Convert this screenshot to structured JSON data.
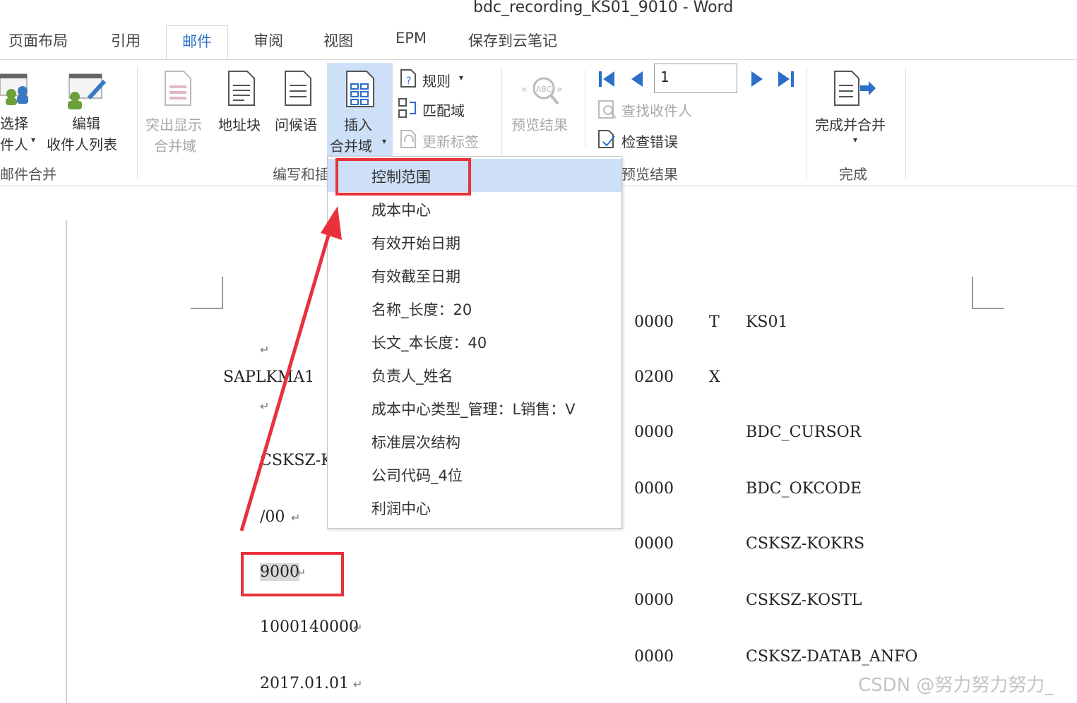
{
  "window": {
    "title": "bdc_recording_KS01_9010 - Word"
  },
  "tabs": [
    {
      "label": "页面布局"
    },
    {
      "label": "引用"
    },
    {
      "label": "邮件",
      "active": true
    },
    {
      "label": "审阅"
    },
    {
      "label": "视图"
    },
    {
      "label": "EPM"
    },
    {
      "label": "保存到云笔记"
    }
  ],
  "ribbon": {
    "groups": {
      "mail_merge": "邮件合并",
      "write_insert": "编写和插",
      "preview": "预览结果",
      "finish": "完成"
    },
    "buttons": {
      "select_recipients_1": "选择",
      "select_recipients_2": "件人",
      "edit_recipients_1": "编辑",
      "edit_recipients_2": "收件人列表",
      "highlight_1": "突出显示",
      "highlight_2": "合并域",
      "address_block": "地址块",
      "greeting": "问候语",
      "insert_field_1": "插入",
      "insert_field_2": "合并域",
      "rules": "规则",
      "match_fields": "匹配域",
      "update_labels": "更新标签",
      "preview_results": "预览结果",
      "find_recipient": "查找收件人",
      "check_errors": "检查错误",
      "finish_merge": "完成并合并"
    },
    "record_number": "1"
  },
  "dropdown": {
    "items": [
      "控制范围",
      "成本中心",
      "有效开始日期",
      "有效截至日期",
      "名称_长度：20",
      "长文_本长度：40",
      "负责人_姓名",
      "成本中心类型_管理：L销售：V",
      "标准层次结构",
      "公司代码_4位",
      "利润中心"
    ],
    "highlighted_index": 0
  },
  "document": {
    "left_column": [
      "SAPLKMA1",
      "CSKSZ-K",
      "/00",
      "9000",
      "1000140000",
      "2017.01.01"
    ],
    "rows": [
      {
        "num": "0000",
        "flag": "T",
        "field": "KS01"
      },
      {
        "num": "0200",
        "flag": "X",
        "field": ""
      },
      {
        "num": "0000",
        "flag": "",
        "field": "BDC_CURSOR"
      },
      {
        "num": "0000",
        "flag": "",
        "field": "BDC_OKCODE"
      },
      {
        "num": "0000",
        "flag": "",
        "field": "CSKSZ-KOKRS"
      },
      {
        "num": "0000",
        "flag": "",
        "field": "CSKSZ-KOSTL"
      },
      {
        "num": "0000",
        "flag": "",
        "field": "CSKSZ-DATAB_ANFO"
      }
    ]
  },
  "colors": {
    "accent": "#2b6fc7",
    "annotation": "#e8313a",
    "highlight": "#cde0f7"
  },
  "watermark": "CSDN @努力努力努力_"
}
